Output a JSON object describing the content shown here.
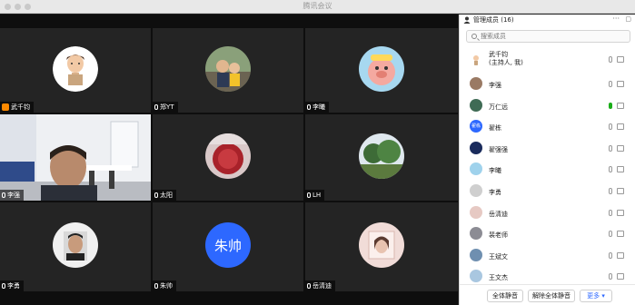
{
  "window": {
    "title": "腾讯会议"
  },
  "tiles": [
    {
      "name": "武千钧",
      "badge": "host"
    },
    {
      "name": "郑YT",
      "badge": "mic"
    },
    {
      "name": "李曦",
      "badge": "mic"
    },
    {
      "name": "李强",
      "badge": "mic"
    },
    {
      "name": "太阳",
      "badge": "mic"
    },
    {
      "name": "LH",
      "badge": "mic"
    },
    {
      "name": "李勇",
      "badge": "mic"
    },
    {
      "name": "朱帅",
      "badge": "mic",
      "avatar_text": "朱帅"
    },
    {
      "name": "岳清迪",
      "badge": "mic"
    }
  ],
  "panel": {
    "title": "管理成员 (16)",
    "more_icon": "···",
    "search_placeholder": "搜索成员",
    "members": [
      {
        "name": "武千钧",
        "sub": "(主持人, 我)"
      },
      {
        "name": "李强"
      },
      {
        "name": "万仁远"
      },
      {
        "name": "翟栋",
        "avatar_text": "翟栋"
      },
      {
        "name": "翟强强"
      },
      {
        "name": "李曦"
      },
      {
        "name": "李勇"
      },
      {
        "name": "岳清迪"
      },
      {
        "name": "裴老师"
      },
      {
        "name": "王斌文"
      },
      {
        "name": "王文杰"
      }
    ],
    "buttons": {
      "mute_all": "全体静音",
      "unmute_all": "解除全体静音",
      "more": "更多 ▾"
    }
  },
  "colors": {
    "accent": "#2d68ff",
    "host_orange": "#ff8a00",
    "mic_active": "#1aad19"
  }
}
